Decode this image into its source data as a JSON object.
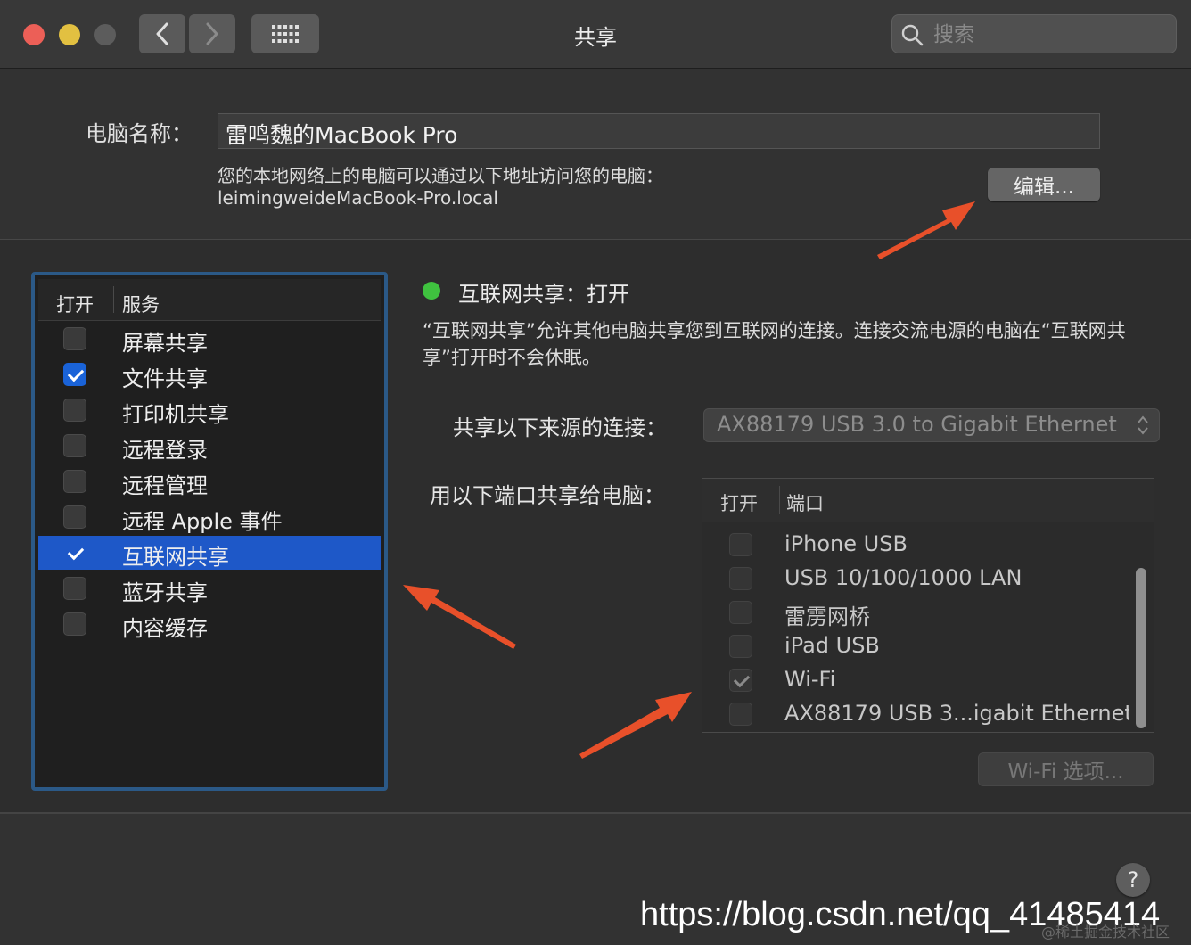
{
  "window": {
    "title": "共享",
    "search_placeholder": "搜索"
  },
  "computer_name": {
    "label": "电脑名称：",
    "value": "雷鸣魏的MacBook Pro",
    "address_desc": "您的本地网络上的电脑可以通过以下地址访问您的电脑：",
    "address_host": "leimingweideMacBook-Pro.local",
    "edit_label": "编辑..."
  },
  "services": {
    "header_on": "打开",
    "header_name": "服务",
    "items": [
      {
        "label": "屏幕共享",
        "checked": false,
        "selected": false
      },
      {
        "label": "文件共享",
        "checked": true,
        "selected": false
      },
      {
        "label": "打印机共享",
        "checked": false,
        "selected": false
      },
      {
        "label": "远程登录",
        "checked": false,
        "selected": false
      },
      {
        "label": "远程管理",
        "checked": false,
        "selected": false
      },
      {
        "label": "远程 Apple 事件",
        "checked": false,
        "selected": false
      },
      {
        "label": "互联网共享",
        "checked": true,
        "selected": true
      },
      {
        "label": "蓝牙共享",
        "checked": false,
        "selected": false
      },
      {
        "label": "内容缓存",
        "checked": false,
        "selected": false
      }
    ]
  },
  "detail": {
    "status_text": "互联网共享：打开",
    "status_color": "#3fc23f",
    "description": "“互联网共享”允许其他电脑共享您到互联网的连接。连接交流电源的电脑在“互联网共享”打开时不会休眠。",
    "source_label": "共享以下来源的连接：",
    "source_value": "AX88179 USB 3.0 to Gigabit Ethernet",
    "ports_label": "用以下端口共享给电脑：",
    "ports_header_on": "打开",
    "ports_header_name": "端口",
    "ports": [
      {
        "label": "iPhone USB",
        "checked": false
      },
      {
        "label": "USB 10/100/1000 LAN",
        "checked": false
      },
      {
        "label": "雷雳网桥",
        "checked": false
      },
      {
        "label": "iPad USB",
        "checked": false
      },
      {
        "label": "Wi-Fi",
        "checked": true
      },
      {
        "label": "AX88179 USB 3...igabit Ethernet",
        "checked": false
      }
    ],
    "wifi_options_label": "Wi-Fi 选项..."
  },
  "help_label": "?",
  "watermark": "https://blog.csdn.net/qq_41485414",
  "watermark_small": "@稀土掘金技术社区",
  "colors": {
    "accent": "#1e58c8",
    "annotation_arrow": "#e8502a"
  }
}
